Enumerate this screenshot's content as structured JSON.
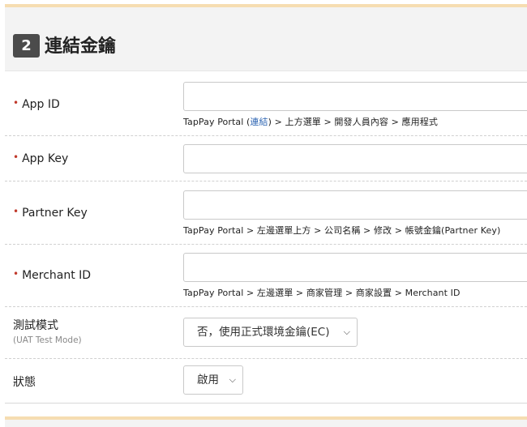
{
  "section": {
    "step": "2",
    "title": "連結金鑰"
  },
  "fields": {
    "app_id": {
      "label": "App ID",
      "value": "",
      "hint_prefix": "TapPay Portal (",
      "hint_link": "連結",
      "hint_suffix": ") > 上方選單 > 開發人員內容 > 應用程式"
    },
    "app_key": {
      "label": "App Key",
      "value": ""
    },
    "partner_key": {
      "label": "Partner Key",
      "value": "",
      "hint": "TapPay Portal > 左邊選單上方 > 公司名稱 > 修改 > 帳號金鑰(Partner Key)"
    },
    "merchant_id": {
      "label": "Merchant ID",
      "value": "",
      "hint": "TapPay Portal > 左邊選單 > 商家管理 > 商家設置 > Merchant ID"
    },
    "test_mode": {
      "label": "測試模式",
      "sublabel": "(UAT Test Mode)",
      "selected": "否，使用正式環境金鑰(EC)"
    },
    "status": {
      "label": "狀態",
      "selected": "啟用"
    }
  },
  "required_marker": "•",
  "colors": {
    "accent_border": "#f6ddb1",
    "link": "#2f66b3",
    "required": "#c0392b",
    "badge": "#4b4b4b"
  },
  "icons": {
    "select_arrow": "chevron-down-icon"
  }
}
